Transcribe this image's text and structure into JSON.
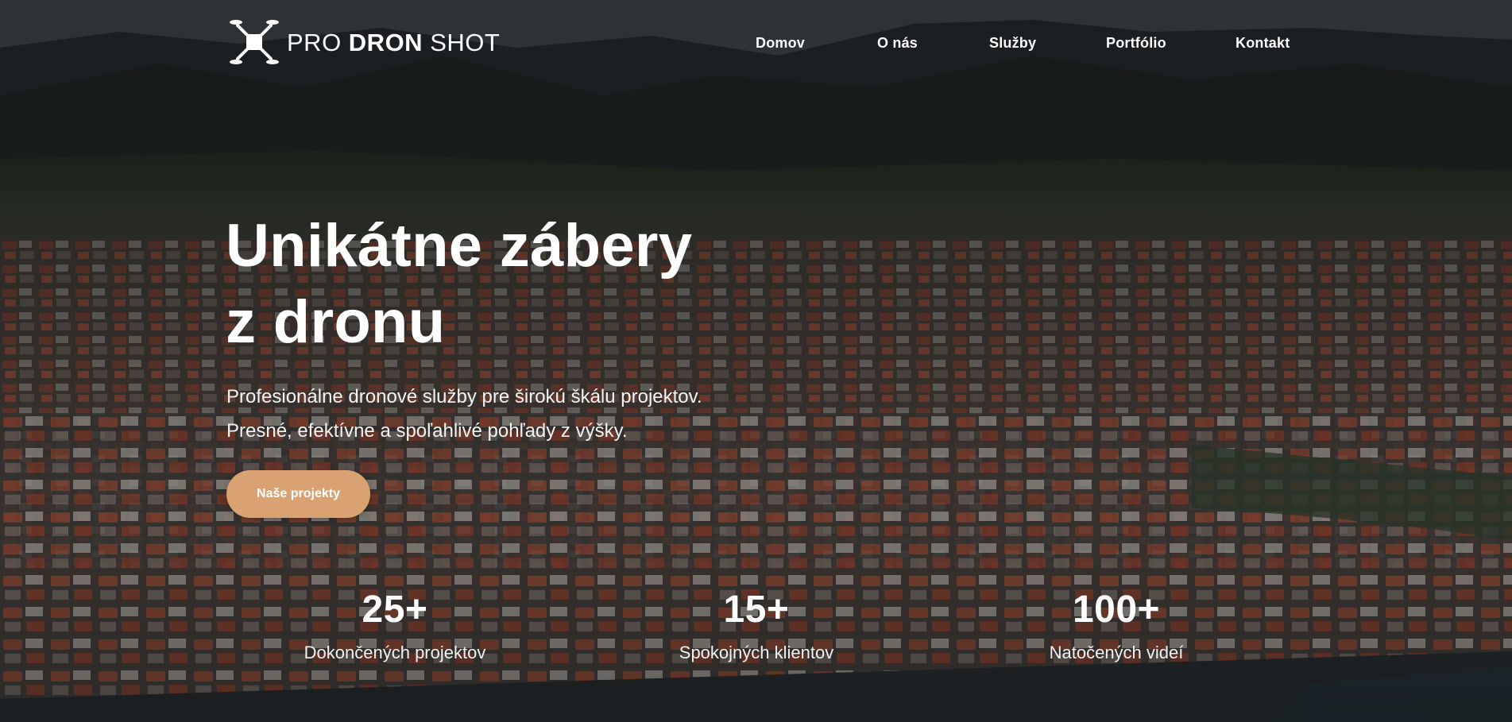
{
  "brand": {
    "logo_text_light": "PRO ",
    "logo_text_bold": "DRON",
    "logo_text_end": " SHOT",
    "logo_icon": "drone-icon"
  },
  "nav": {
    "items": [
      {
        "label": "Domov"
      },
      {
        "label": "O nás"
      },
      {
        "label": "Služby"
      },
      {
        "label": "Portfólio"
      },
      {
        "label": "Kontakt"
      }
    ]
  },
  "hero": {
    "title_line1": "Unikátne zábery",
    "title_line2": "z dronu",
    "subtitle_line1": "Profesionálne dronové služby pre širokú škálu projektov.",
    "subtitle_line2": "Presné, efektívne a spoľahlivé pohľady z výšky.",
    "cta_label": "Naše projekty"
  },
  "stats": [
    {
      "value": "25+",
      "label": "Dokončených projektov"
    },
    {
      "value": "15+",
      "label": "Spokojných klientov"
    },
    {
      "value": "100+",
      "label": "Natočených videí"
    }
  ],
  "colors": {
    "accent": "#d9a272",
    "text": "#ffffff",
    "overlay": "#0a0c0e"
  }
}
